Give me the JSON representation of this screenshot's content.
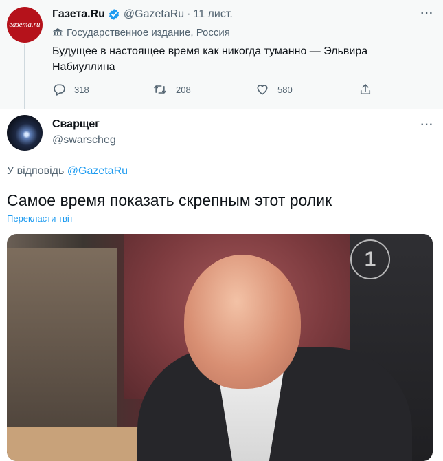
{
  "parent_tweet": {
    "avatar_text": "газета.ru",
    "name": "Газета.Ru",
    "handle": "@GazetaRu",
    "separator": "·",
    "time": "11 лист.",
    "label": "Государственное издание, Россия",
    "text": "Будущее в настоящее время как никогда туманно — Эльвира Набиуллина",
    "stats": {
      "replies": "318",
      "retweets": "208",
      "likes": "580"
    }
  },
  "reply_tweet": {
    "name": "Сварщег",
    "handle": "@swarscheg",
    "reply_prefix": "У відповідь",
    "reply_handle": "@GazetaRu",
    "text": "Самое время показать скрепным этот ролик",
    "translate_label": "Перекласти твіт",
    "media": {
      "channel_logo": "1"
    }
  },
  "colors": {
    "accent": "#1d9bf0",
    "text": "#0f1419",
    "muted": "#536471",
    "parent_bg": "#f7f9f9",
    "avatar_red": "#b5121b"
  },
  "icons": [
    "verified-badge-icon",
    "government-building-icon",
    "more-icon",
    "reply-icon",
    "retweet-icon",
    "like-icon",
    "share-icon"
  ]
}
